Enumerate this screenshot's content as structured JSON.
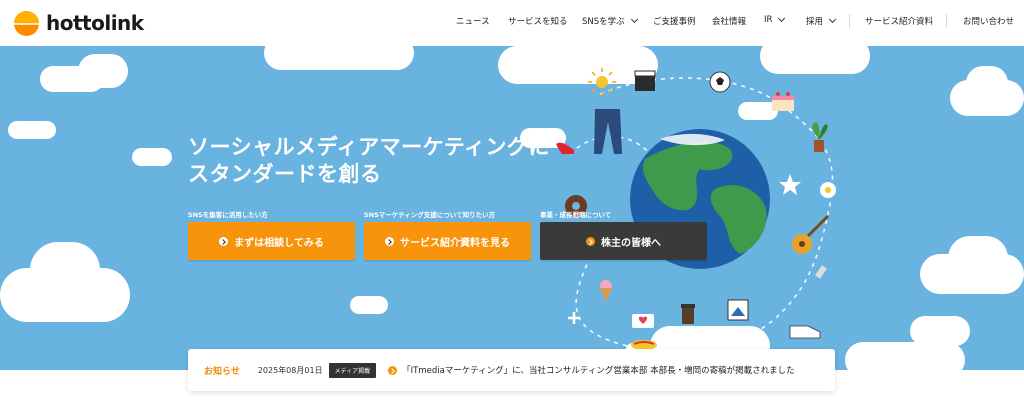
{
  "brand": {
    "name": "hottolink",
    "accent": "#f8930c",
    "hero_bg": "#69b3e0"
  },
  "nav": {
    "items": [
      {
        "label": "ニュース",
        "has_dropdown": false
      },
      {
        "label": "サービスを知る",
        "has_dropdown": false
      },
      {
        "label": "SNSを学ぶ",
        "has_dropdown": true
      },
      {
        "label": "ご支援事例",
        "has_dropdown": false
      },
      {
        "label": "会社情報",
        "has_dropdown": false
      },
      {
        "label": "IR",
        "has_dropdown": true
      },
      {
        "label": "採用",
        "has_dropdown": true
      },
      {
        "label": "サービス紹介資料",
        "has_dropdown": false
      },
      {
        "label": "お問い合わせ",
        "has_dropdown": false
      }
    ]
  },
  "hero": {
    "title_line1": "ソーシャルメディアマーケティングに",
    "title_line2": "スタンダードを創る",
    "ctas": [
      {
        "caption": "SNSを集客に活用したい方",
        "label": "まずは相談してみる",
        "style": "orange"
      },
      {
        "caption": "SNSマーケティング支援について知りたい方",
        "label": "サービス紹介資料を見る",
        "style": "orange"
      },
      {
        "caption": "事業・成長戦略について",
        "label": "株主の皆様へ",
        "style": "dark"
      }
    ],
    "illustration_icons": [
      "sun-icon",
      "clapperboard-icon",
      "soccer-ball-icon",
      "cake-icon",
      "plant-icon",
      "jeans-icon",
      "high-heel-icon",
      "donut-icon",
      "star-icon",
      "flower-icon",
      "guitar-icon",
      "ice-cream-icon",
      "coffee-cup-icon",
      "photo-icon",
      "sneaker-icon",
      "omelette-icon",
      "heart-message-icon",
      "lipstick-icon",
      "globe-icon"
    ]
  },
  "news": {
    "label": "お知らせ",
    "date": "2025年08月01日",
    "tag": "メディア掲載",
    "text": "「ITmediaマーケティング」に、当社コンサルティング営業本部 本部長・増岡の寄稿が掲載されました"
  }
}
